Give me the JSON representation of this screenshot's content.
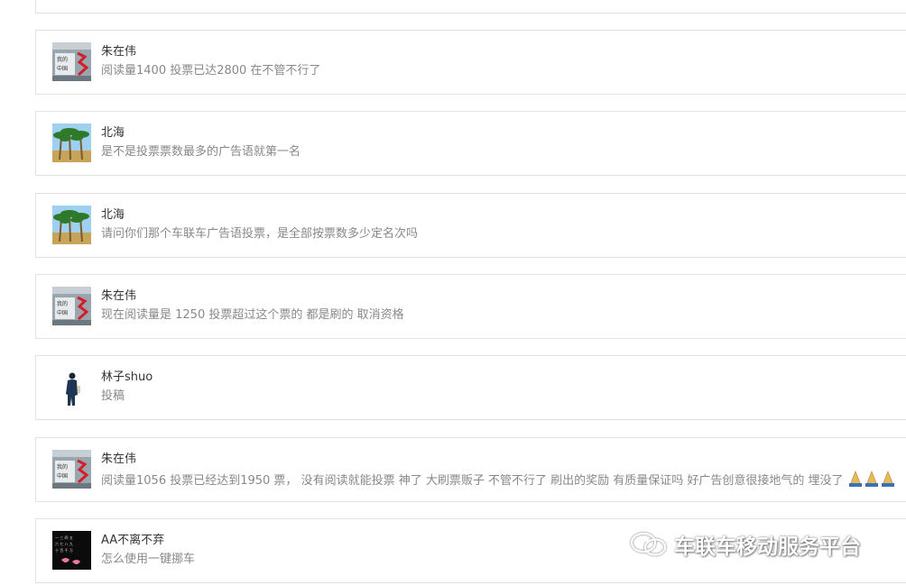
{
  "comments": [
    {
      "nickname": "朱在伟",
      "content": "阅读量1400 投票已达2800 在不管不行了",
      "avatar": "red-sign-avatar"
    },
    {
      "nickname": "北海",
      "content": "是不是投票票数最多的广告语就第一名",
      "avatar": "palm-trees-avatar"
    },
    {
      "nickname": "北海",
      "content": "请问你们那个车联车广告语投票，是全部按票数多少定名次吗",
      "avatar": "palm-trees-avatar"
    },
    {
      "nickname": "朱在伟",
      "content": "现在阅读量是 1250 投票超过这个票的 都是刷的 取消资格",
      "avatar": "red-sign-avatar"
    },
    {
      "nickname": "林子shuo",
      "content": "投稿",
      "avatar": "standing-person-avatar"
    },
    {
      "nickname": "朱在伟",
      "content": "阅读量1056 投票已经达到1950 票， 没有阅读就能投票 神了 大刷票贩子 不管不行了 刷出的奖励 有质量保证吗 好广告创意很接地气的 埋没了",
      "avatar": "red-sign-avatar",
      "trailing_emoji": "folded-hands-emoji x3"
    },
    {
      "nickname": "AA不离不弃",
      "content": "怎么使用一键挪车",
      "avatar": "dark-calligraphy-avatar"
    }
  ],
  "watermark": {
    "text": "车联车移动服务平台",
    "icon": "wechat-icon"
  }
}
